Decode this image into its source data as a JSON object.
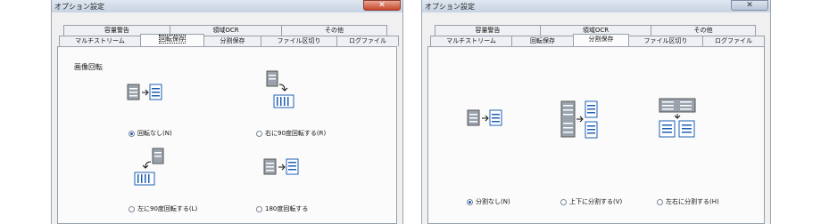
{
  "dialog1": {
    "title": "オプション設定",
    "close_glyph": "✕",
    "tabs_back": [
      "容量警告",
      "領域OCR",
      "その他"
    ],
    "tabs_front": [
      "マルチストリーム",
      "回転保存",
      "分割保存",
      "ファイル区切り",
      "ログファイル"
    ],
    "active_tab": "回転保存",
    "section_label": "画像回転",
    "options": [
      {
        "label": "回転なし(N)",
        "selected": true
      },
      {
        "label": "右に90度回転する(R)",
        "selected": false
      },
      {
        "label": "左に90度回転する(L)",
        "selected": false
      },
      {
        "label": "180度回転する",
        "selected": false
      }
    ]
  },
  "dialog2": {
    "title": "オプション設定",
    "close_glyph": "✕",
    "tabs_back": [
      "容量警告",
      "領域OCR",
      "その他"
    ],
    "tabs_front": [
      "マルチストリーム",
      "回転保存",
      "分割保存",
      "ファイル区切り",
      "ログファイル"
    ],
    "active_tab": "分割保存",
    "options": [
      {
        "label": "分割なし(N)",
        "selected": true
      },
      {
        "label": "上下に分割する(V)",
        "selected": false
      },
      {
        "label": "左右に分割する(H)",
        "selected": false
      }
    ]
  }
}
